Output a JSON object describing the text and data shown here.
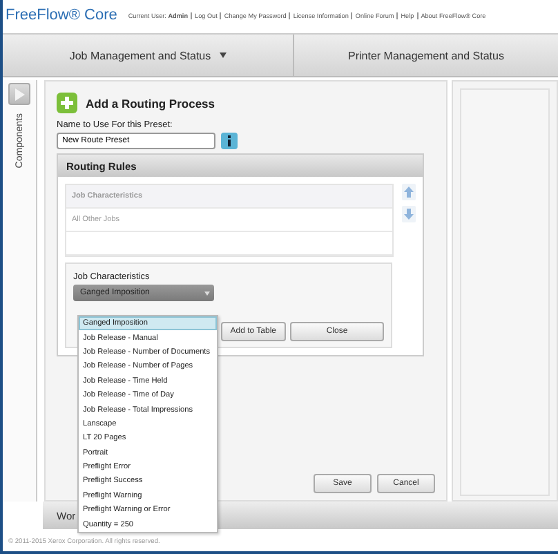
{
  "header": {
    "logo": "FreeFlow® Core",
    "links": [
      "Current User: **Admin**",
      "Log Out",
      "Change My Password",
      "License Information",
      "Online Forum",
      "Help",
      "About FreeFlow® Core"
    ]
  },
  "nav_tabs": [
    {
      "label": "Job Management and Status",
      "has_menu": true
    },
    {
      "label": "Printer Management and Status",
      "has_menu": false
    }
  ],
  "sidebar": {
    "label": "Components"
  },
  "form": {
    "title": "Add a Routing Process",
    "name_label": "Name to Use For this Preset:",
    "name_value": "New Route Preset",
    "routing_rules": {
      "title": "Routing Rules",
      "table_header": "Job Characteristics",
      "rows": [
        "All Other Jobs",
        ""
      ],
      "editor": {
        "label": "Job Characteristics",
        "select_value": "Ganged Imposition",
        "buttons": [
          "Add to Table",
          "Close"
        ]
      }
    },
    "buttons": [
      "Save",
      "Cancel"
    ]
  },
  "bottom_bar": {
    "label": "Wor"
  },
  "dropdown": [
    {
      "label": "Ganged Imposition",
      "selected": true
    },
    {
      "label": "Job Release - Manual",
      "selected": false
    },
    {
      "label": "Job Release - Number of Documents",
      "selected": false
    },
    {
      "label": "Job Release - Number of Pages",
      "selected": false
    },
    {
      "label": "Job Release - Time Held",
      "selected": false
    },
    {
      "label": "Job Release - Time of Day",
      "selected": false
    },
    {
      "label": "Job Release - Total Impressions",
      "selected": false
    },
    {
      "label": "Lanscape",
      "selected": false
    },
    {
      "label": "LT 20 Pages",
      "selected": false
    },
    {
      "label": "Portrait",
      "selected": false
    },
    {
      "label": "Preflight Error",
      "selected": false
    },
    {
      "label": "Preflight Success",
      "selected": false
    },
    {
      "label": "Preflight Warning",
      "selected": false
    },
    {
      "label": "Preflight Warning or Error",
      "selected": false
    },
    {
      "label": "Quantity = 250",
      "selected": false
    }
  ],
  "footer": "© 2011-2015 Xerox Corporation. All rights reserved."
}
